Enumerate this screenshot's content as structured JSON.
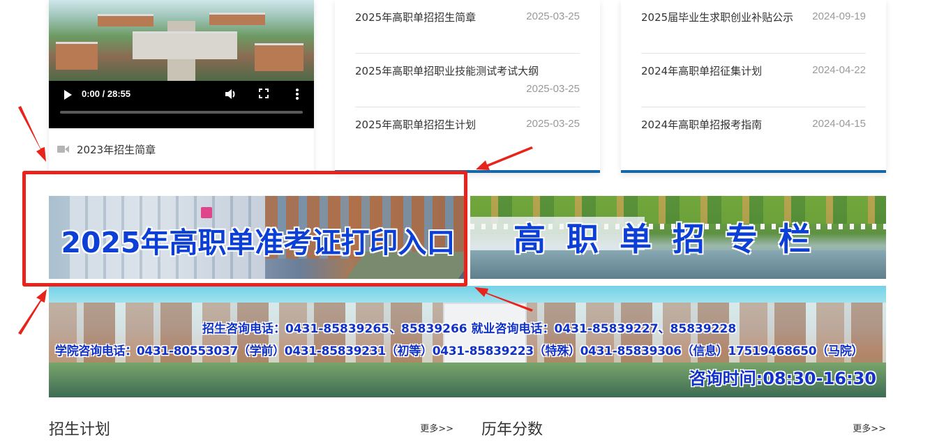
{
  "video": {
    "time": "0:00 / 28:55",
    "caption": "2023年招生简章",
    "caption_icon": "video-camera-icon",
    "controls": [
      "play-icon",
      "volume-icon",
      "fullscreen-icon",
      "more-options-icon"
    ]
  },
  "news_left": [
    {
      "title": "2025年高职单招招生简章",
      "date": "2025-03-25"
    },
    {
      "title": "2025年高职单招职业技能测试考试大纲",
      "date": "2025-03-25"
    },
    {
      "title": "2025年高职单招招生计划",
      "date": "2025-03-25"
    }
  ],
  "news_right": [
    {
      "title": "2025届毕业生求职创业补贴公示",
      "date": "2024-09-19"
    },
    {
      "title": "2024年高职单招征集计划",
      "date": "2024-04-22"
    },
    {
      "title": "2024年高职单招报考指南",
      "date": "2024-04-15"
    }
  ],
  "banners": {
    "admission_ticket": "2025年高职单准考证打印入口",
    "column": "高职单招专栏",
    "contact_line1": "招生咨询电话：0431-85839265、85839266 就业咨询电话：0431-85839227、85839228",
    "contact_line2": "学院咨询电话：0431-80553037（学前）0431-85839231（初等）0431-85839223（特殊）0431-85839306（信息）17519468650（马院）",
    "consult_time": "咨询时间:08:30-16:30"
  },
  "sections": [
    {
      "title": "招生计划",
      "more": "更多>>"
    },
    {
      "title": "历年分数",
      "more": "更多>>"
    }
  ],
  "colors": {
    "accent_blue": "#1868a8",
    "annotation_red": "#e8231b",
    "banner_text_blue": "#0b3fd6"
  }
}
